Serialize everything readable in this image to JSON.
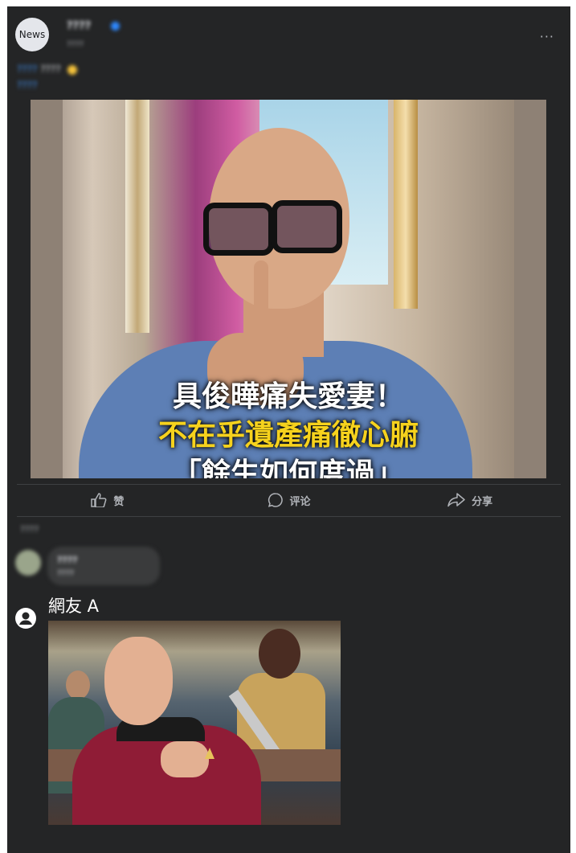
{
  "post": {
    "page_name": "????",
    "time": "????",
    "caption_hashtag": "????",
    "caption_text": "????",
    "caption_link": "????",
    "more_label": "···",
    "overlay_lines": [
      "具俊曄痛失愛妻！",
      "不在乎遺產痛徹心腑",
      "「餘生如何度過」"
    ],
    "avatar_text": "News"
  },
  "actions": {
    "like": "赞",
    "comment": "评论",
    "share": "分享"
  },
  "comments": {
    "sort_label": "????",
    "first": {
      "name": "????",
      "text": "????"
    },
    "second": {
      "name": "網友 A"
    }
  },
  "colors": {
    "background": "#242526",
    "text": "#e4e6eb",
    "muted": "#b0b3b8",
    "overlay_yellow": "#f6d21d"
  }
}
